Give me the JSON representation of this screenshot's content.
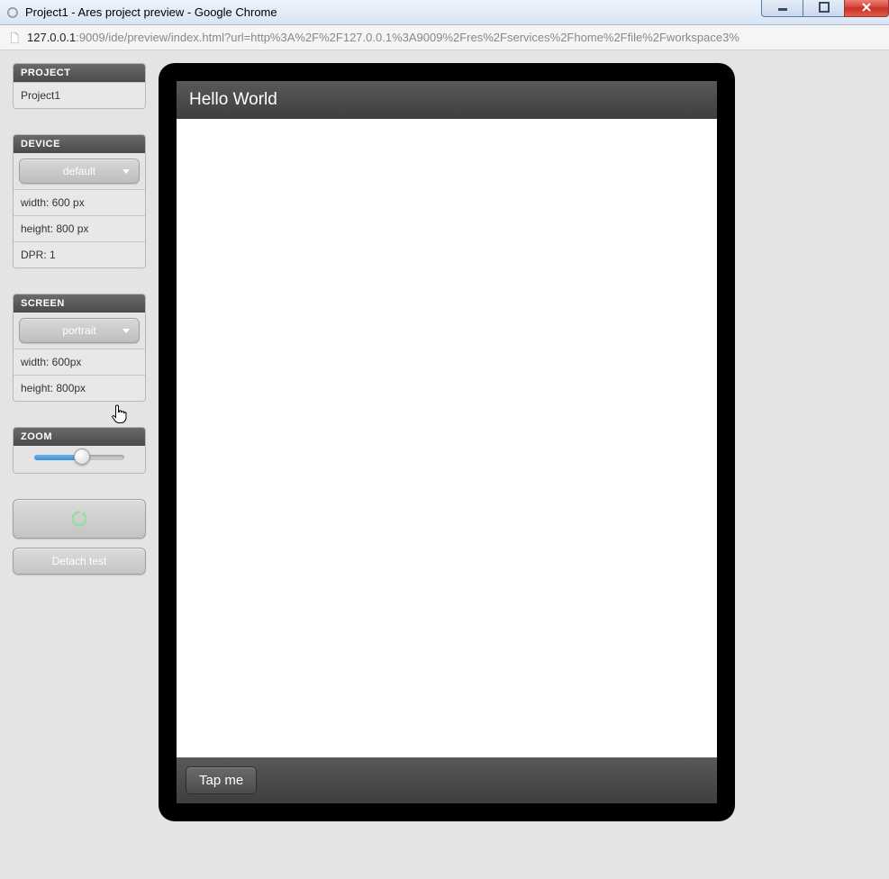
{
  "window": {
    "title": "Project1 - Ares project preview - Google Chrome"
  },
  "addressbar": {
    "host": "127.0.0.1",
    "rest": ":9009/ide/preview/index.html?url=http%3A%2F%2F127.0.0.1%3A9009%2Fres%2Fservices%2Fhome%2Ffile%2Fworkspace3%"
  },
  "sidebar": {
    "project": {
      "header": "PROJECT",
      "value": "Project1"
    },
    "device": {
      "header": "DEVICE",
      "selected": "default",
      "width": "width: 600 px",
      "height": "height: 800 px",
      "dpr": "DPR: 1"
    },
    "screen": {
      "header": "SCREEN",
      "selected": "portrait",
      "width": "width: 600px",
      "height": "height: 800px"
    },
    "zoom": {
      "header": "ZOOM"
    },
    "detach_label": "Detach test"
  },
  "preview": {
    "header_text": "Hello World",
    "footer_button": "Tap me"
  }
}
